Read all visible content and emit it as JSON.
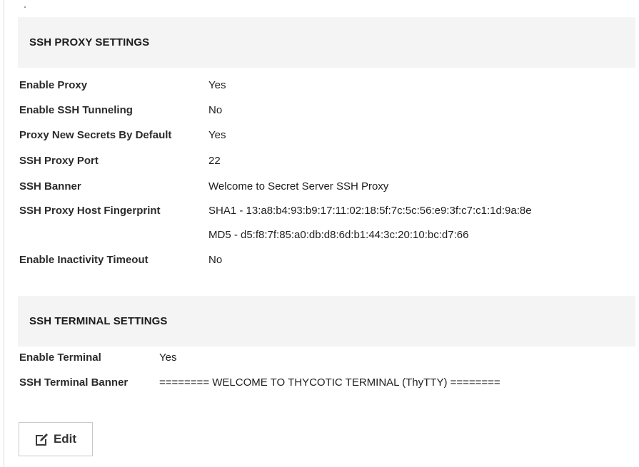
{
  "proxy_settings": {
    "title": "SSH PROXY SETTINGS",
    "rows": [
      {
        "label": "Enable Proxy",
        "value": "Yes"
      },
      {
        "label": "Enable SSH Tunneling",
        "value": "No"
      },
      {
        "label": "Proxy New Secrets By Default",
        "value": "Yes"
      },
      {
        "label": "SSH Proxy Port",
        "value": "22"
      },
      {
        "label": "SSH Banner",
        "value": "Welcome to Secret Server SSH Proxy"
      },
      {
        "label": "SSH Proxy Host Fingerprint",
        "value": "SHA1 - 13:a8:b4:93:b9:17:11:02:18:5f:7c:5c:56:e9:3f:c7:c1:1d:9a:8e"
      },
      {
        "label": "",
        "value": "MD5 - d5:f8:7f:85:a0:db:d8:6d:b1:44:3c:20:10:bc:d7:66"
      },
      {
        "label": "Enable Inactivity Timeout",
        "value": "No"
      }
    ]
  },
  "terminal_settings": {
    "title": "SSH TERMINAL SETTINGS",
    "rows": [
      {
        "label": "Enable Terminal",
        "value": "Yes"
      },
      {
        "label": "SSH Terminal Banner",
        "value": "======== WELCOME TO THYCOTIC TERMINAL (ThyTTY) ========"
      }
    ]
  },
  "actions": {
    "edit_label": "Edit",
    "edit_icon": "edit-icon"
  }
}
